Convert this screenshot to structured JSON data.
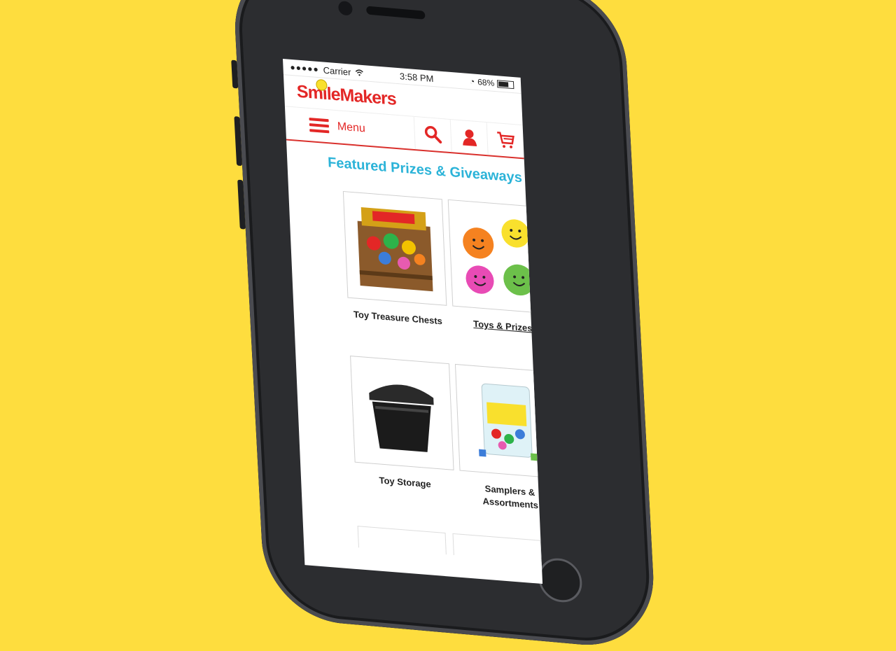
{
  "status_bar": {
    "carrier": "Carrier",
    "time": "3:58 PM",
    "battery": "68%"
  },
  "brand": {
    "logo_text": "SmileMakers",
    "accent_color": "#E32726",
    "title_color": "#2BB3D8",
    "background_color": "#FEDD3E"
  },
  "nav": {
    "menu_label": "Menu",
    "icons": [
      "search-icon",
      "account-icon",
      "cart-icon"
    ]
  },
  "section": {
    "title": "Featured Prizes & Giveaways"
  },
  "tiles": [
    {
      "label": "Toy Treasure Chests",
      "linked": false
    },
    {
      "label": "Toys & Prizes",
      "linked": true
    },
    {
      "label": "Toy Storage",
      "linked": false
    },
    {
      "label": "Samplers & Assortments",
      "linked": false
    }
  ]
}
